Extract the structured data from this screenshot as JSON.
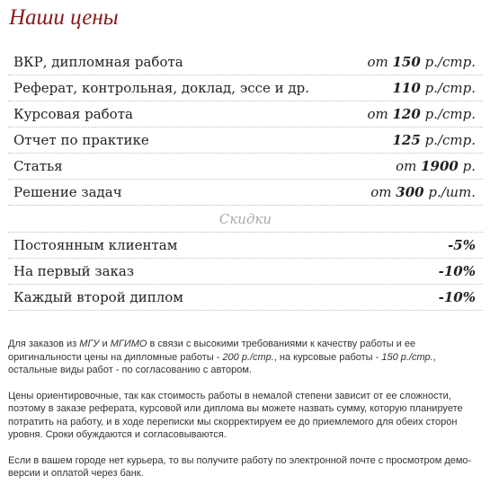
{
  "title": "Наши цены",
  "prices": [
    {
      "name": "ВКР, дипломная работа",
      "prefix": "от ",
      "amount": "150",
      "unit": " р./стр."
    },
    {
      "name": "Реферат, контрольная, доклад, эссе и др.",
      "prefix": "",
      "amount": "110",
      "unit": " р./стр."
    },
    {
      "name": "Курсовая работа",
      "prefix": "от ",
      "amount": "120",
      "unit": " р./стр."
    },
    {
      "name": "Отчет по практике",
      "prefix": "",
      "amount": "125",
      "unit": " р./стр."
    },
    {
      "name": "Статья",
      "prefix": "от ",
      "amount": "1900",
      "unit": " р."
    },
    {
      "name": "Решение задач",
      "prefix": "от ",
      "amount": "300",
      "unit": " р./шт."
    }
  ],
  "discounts_heading": "Скидки",
  "discounts": [
    {
      "name": "Постоянным клиентам",
      "value": "-5%"
    },
    {
      "name": "На первый заказ",
      "value": "-10%"
    },
    {
      "name": "Каждый второй диплом",
      "value": "-10%"
    }
  ],
  "notes": {
    "p1": {
      "t1": "Для заказов из ",
      "mgu": "МГУ",
      "t2": " и ",
      "mgimo": "МГИМО",
      "t3": " в связи с высокими требованиями к качеству работы и ее оригинальности цены на дипломные работы - ",
      "diploma_price": "200 р./стр.",
      "t4": ", на курсовые работы - ",
      "course_price": "150 р./стр.",
      "t5": ", остальные виды работ - по согласованию с автором."
    },
    "p2": "Цены ориентировочные, так как стоимость работы в немалой степени зависит от ее сложности, поэтому в заказе реферата, курсовой или диплома вы можете назвать сумму, которую планируете потратить на работу, и в ходе переписки мы скорректируем ее до приемлемого для обеих сторон уровня. Сроки обуждаются и согласовываются.",
    "p3": "Если в вашем городе нет курьера, то вы получите работу по электронной почте с просмотром демо-версии и оплатой через банк."
  }
}
